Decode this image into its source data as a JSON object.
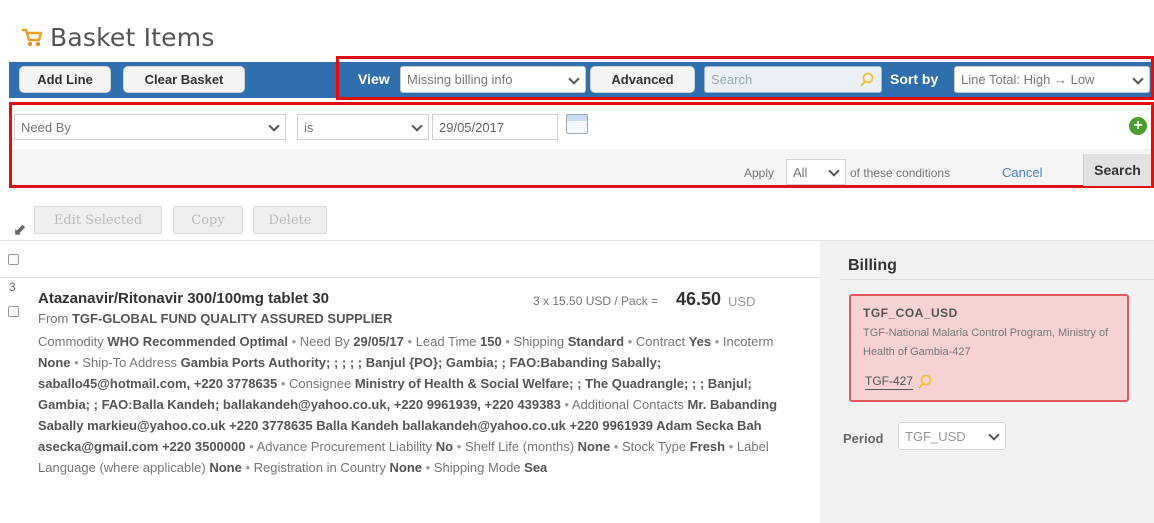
{
  "page": {
    "title": "Basket Items",
    "icon": "basket-icon"
  },
  "toolbar": {
    "add_line": "Add Line",
    "clear_basket": "Clear Basket",
    "view_label": "View",
    "view_value": "Missing billing info",
    "advanced": "Advanced",
    "search_placeholder": "Search",
    "sort_label": "Sort by",
    "sort_value": "Line Total: High → Low",
    "accent_color": "#2f6fad",
    "highlight_color": "#e01010"
  },
  "filter": {
    "field": "Need By",
    "operator": "is",
    "date": "29/05/2017",
    "apply_label": "Apply",
    "apply_value": "All",
    "apply_suffix": "of these conditions",
    "cancel": "Cancel",
    "search": "Search"
  },
  "actions": {
    "edit_selected": "Edit Selected",
    "copy": "Copy",
    "delete": "Delete"
  },
  "item": {
    "row_number": "3",
    "name": "Atazanavir/Ritonavir 300/100mg tablet 30",
    "unit_price_text": "3 x 15.50 USD / Pack =",
    "total": "46.50",
    "currency": "USD",
    "supplier_prefix": "From",
    "supplier": "TGF-GLOBAL FUND QUALITY ASSURED SUPPLIER",
    "commodity_label": "Commodity",
    "commodity": "WHO Recommended Optimal",
    "need_by_label": "Need By",
    "need_by": "29/05/17",
    "lead_time_label": "Lead Time",
    "lead_time": "150",
    "shipping_label": "Shipping",
    "shipping": "Standard",
    "contract_label": "Contract",
    "contract": "Yes",
    "incoterm_label": "Incoterm",
    "incoterm": "None",
    "ship_to_label": "Ship-To Address",
    "ship_to": "Gambia Ports Authority; ; ; ; ; Banjul {PO}; Gambia; ; FAO:Babanding Sabally; saballo45@hotmail.com, +220 3778635",
    "consignee_label": "Consignee",
    "consignee": "Ministry of Health & Social Welfare; ; The Quadrangle; ; ; Banjul; Gambia; ; FAO:Balla Kandeh; ballakandeh@yahoo.co.uk, +220 9961939, +220 439383",
    "contacts_label": "Additional Contacts",
    "contacts": "Mr. Babanding Sabally markieu@yahoo.co.uk +220 3778635 Balla Kandeh ballakandeh@yahoo.co.uk +220 9961939 Adam Secka Bah asecka@gmail.com +220 3500000",
    "liability_label": "Advance Procurement Liability",
    "liability": "No",
    "shelf_life_label": "Shelf Life (months)",
    "shelf_life": "None",
    "stock_type_label": "Stock Type",
    "stock_type": "Fresh",
    "label_lang_label": "Label Language (where applicable)",
    "label_lang": "None",
    "registration_label": "Registration in Country",
    "registration": "None",
    "shipping_mode_label": "Shipping Mode",
    "shipping_mode": "Sea"
  },
  "billing": {
    "heading": "Billing",
    "code": "TGF_COA_USD",
    "description": "TGF-National Malaria Control Program, Ministry of Health of Gambia-427",
    "id": "TGF-427",
    "period_label": "Period",
    "period_value": "TGF_USD",
    "card_bg": "#f6d2d2",
    "card_border": "#e05a5a"
  }
}
